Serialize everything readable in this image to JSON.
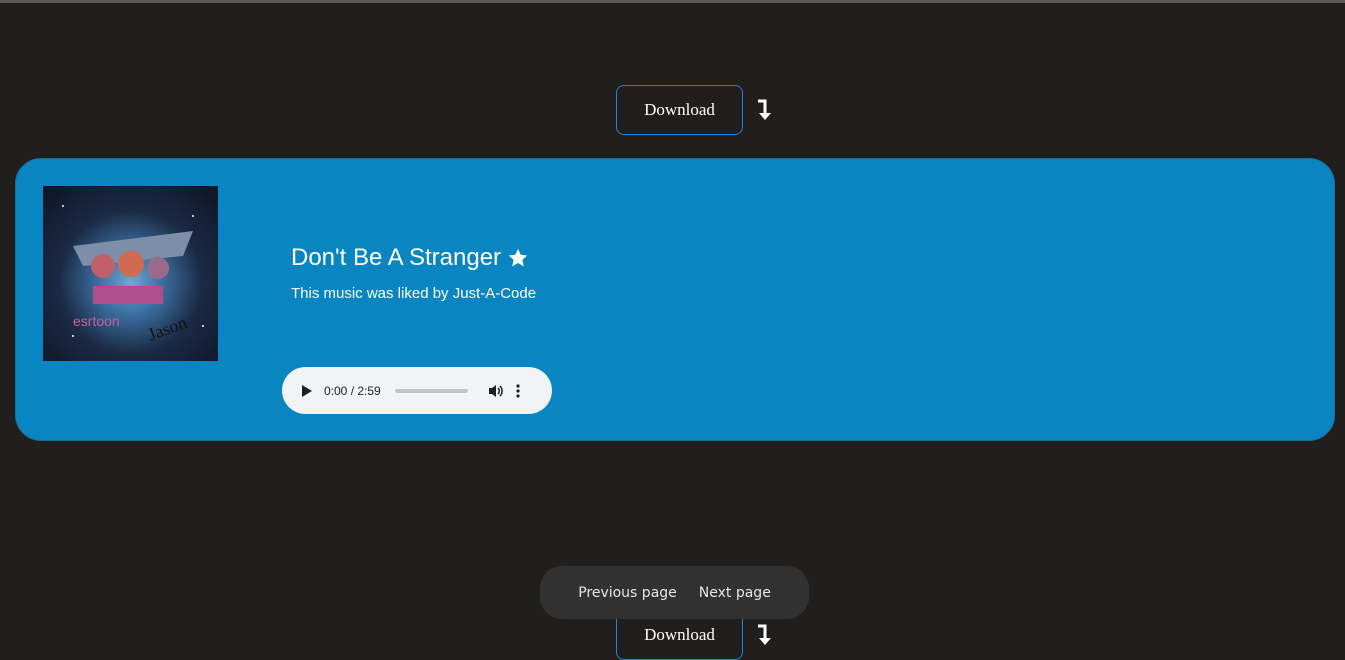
{
  "download": {
    "label": "Download"
  },
  "song": {
    "title": "Don't Be A Stranger",
    "liked_by_text": "This music was liked by Just-A-Code",
    "favorite": true
  },
  "player": {
    "time": "0:00 / 2:59",
    "progress": 0
  },
  "pagination": {
    "previous": "Previous page",
    "next": "Next page"
  },
  "colors": {
    "card": "#0985c1",
    "background": "#201f1e",
    "button_border": "#2f7fd8"
  }
}
